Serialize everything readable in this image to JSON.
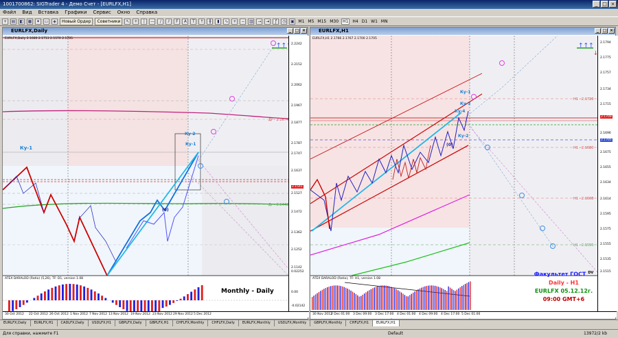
{
  "app": {
    "title": "1001700862: SIGTrader 4 - Демо Счет - [EURLFX,H1]",
    "menu": [
      "Файл",
      "Вид",
      "Вставка",
      "Графики",
      "Сервис",
      "Окно",
      "Справка"
    ],
    "toolbar": {
      "new_order": "Новый Ордер",
      "experts": "Советники",
      "timeframes": [
        "M1",
        "M5",
        "M15",
        "M30",
        "H1",
        "H4",
        "D1",
        "W1",
        "MN"
      ],
      "active_timeframe": "H1"
    }
  },
  "left_chart": {
    "window_title": "EURLFX,Daily",
    "symbol_info": "EURLFX,Daily  2.1680 2.1713 2.1570 2.1705",
    "price_ticks": [
      "2.2242",
      "2.2152",
      "2.2062",
      "2.1967",
      "2.1877",
      "2.1787",
      "2.1747",
      "2.1637",
      "2.1527",
      "2.1472",
      "2.1362",
      "2.1252",
      "2.1142"
    ],
    "highlight_price": "2.1541",
    "level_labels": {
      "dn1": "Дг - 2.1674",
      "dn2": "Дг - 2.1442",
      "ky1": "Ку-1",
      "ky2": "Ку-2",
      "ky1b": "Ку-1",
      "zero": "(0)"
    },
    "sub_ticks": [
      "0.02252",
      "0.00",
      "-0.02142"
    ],
    "sub_info": "ATEX DARALOD (Ratio) (5,26), TF: D1, version 1.08",
    "time_labels": [
      "30 Oct 2012",
      "22 Oct 2012",
      "26 Oct 2012",
      "1 Nov 2012",
      "7 Nov 2012",
      "13 Nov 2012",
      "19 Nov 2012",
      "23 Nov 2012",
      "29 Nov 2012",
      "5 Dec 2012"
    ],
    "caption": "Monthly - Daily"
  },
  "right_chart": {
    "window_title": "EURLFX,H1",
    "symbol_info": "EURLFX,H1  2.1766 2.1767 2.1700 2.1705",
    "price_ticks": [
      "2.1794",
      "2.1775",
      "2.1757",
      "2.1734",
      "2.1715",
      "2.1696",
      "2.1675",
      "2.1655",
      "2.1634",
      "2.1614",
      "2.1595",
      "2.1575",
      "2.1555",
      "2.1535",
      "2.1515"
    ],
    "highlight_prices": [
      "2.1709",
      "2.1705"
    ],
    "level_labels": {
      "h1a": "Н1 - 2.1726",
      "h1b": "Н1 - 2.1680",
      "h1c": "Н1 - 2.1608",
      "h1d": "Н1 - 2.1555",
      "ky1": "Ку-1",
      "ky3": "Ку-3",
      "ky4": "Ку-4",
      "ky2": "Ку-2",
      "zero": "(0)"
    },
    "sub_info": "ATEX DARALOD (Ratio), TF: H1, version 1.08",
    "time_labels": [
      "30 Nov 2012",
      "2 Dec 01:00",
      "3 Dec 09:00",
      "3 Dec 17:00",
      "4 Dec 01:00",
      "4 Dec 09:00",
      "4 Dec 17:00",
      "5 Dec 01:00"
    ],
    "caption": {
      "line1": "Факультет ГОСТ",
      "dv": "DV",
      "line2": "Daily - H1",
      "line3": "EURLFX 05.12.12г.",
      "line4": "09:00 GMT+6"
    },
    "colors": {
      "caption1": "#1a1aff",
      "caption2": "#ff3030",
      "caption3": "#109010",
      "caption4": "#c00000"
    }
  },
  "tabs": [
    "EURLFX,Daily",
    "EURLFX,H1",
    "CADLFX,Daily",
    "USDLFX,H1",
    "GBPLFX,Daily",
    "GBPLFX,H1",
    "CHFLFX,Monthly",
    "CHFLFX,Daily",
    "EURLFX,Monthly",
    "USDLFX,Monthly",
    "GBPLFX,Monthly",
    "CHFLFX,H1",
    "EURLFX,H1"
  ],
  "active_tab_index": 12,
  "status": {
    "help": "Для справки, нажмите F1",
    "profile": "Default",
    "traffic": "13972/2 kb"
  }
}
